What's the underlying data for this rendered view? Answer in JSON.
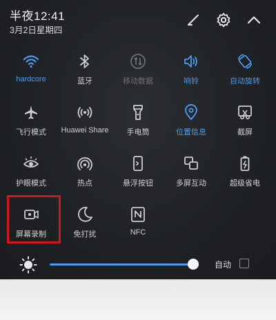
{
  "status": {
    "time": "半夜12:41",
    "date": "3月2日星期四"
  },
  "tiles": [
    {
      "label": "hardcore",
      "icon": "wifi-icon",
      "state": "active"
    },
    {
      "label": "蓝牙",
      "icon": "bluetooth-icon",
      "state": "normal"
    },
    {
      "label": "移动数据",
      "icon": "mobile-data-icon",
      "state": "dim"
    },
    {
      "label": "响铃",
      "icon": "ring-volume-icon",
      "state": "active"
    },
    {
      "label": "自动旋转",
      "icon": "auto-rotate-icon",
      "state": "active"
    },
    {
      "label": "飞行模式",
      "icon": "airplane-icon",
      "state": "normal"
    },
    {
      "label": "Huawei Share",
      "icon": "huawei-share-icon",
      "state": "normal"
    },
    {
      "label": "手电筒",
      "icon": "flashlight-icon",
      "state": "normal"
    },
    {
      "label": "位置信息",
      "icon": "location-icon",
      "state": "active"
    },
    {
      "label": "截屏",
      "icon": "screenshot-icon",
      "state": "normal"
    },
    {
      "label": "护眼模式",
      "icon": "eye-comfort-icon",
      "state": "normal"
    },
    {
      "label": "热点",
      "icon": "hotspot-icon",
      "state": "normal"
    },
    {
      "label": "悬浮按钮",
      "icon": "floating-button-icon",
      "state": "normal"
    },
    {
      "label": "多屏互动",
      "icon": "multi-screen-icon",
      "state": "normal"
    },
    {
      "label": "超级省电",
      "icon": "battery-saver-icon",
      "state": "normal"
    },
    {
      "label": "屏幕录制",
      "icon": "screen-record-icon",
      "state": "normal"
    },
    {
      "label": "免打扰",
      "icon": "do-not-disturb-icon",
      "state": "normal"
    },
    {
      "label": "NFC",
      "icon": "nfc-icon",
      "state": "normal"
    }
  ],
  "brightness": {
    "level": 0.95,
    "auto_label": "自动",
    "auto_checked": false
  },
  "colors": {
    "accent": "#4d9bf0",
    "highlight": "#d0181c",
    "text": "#d0d0d0",
    "dim": "#6d7075"
  }
}
